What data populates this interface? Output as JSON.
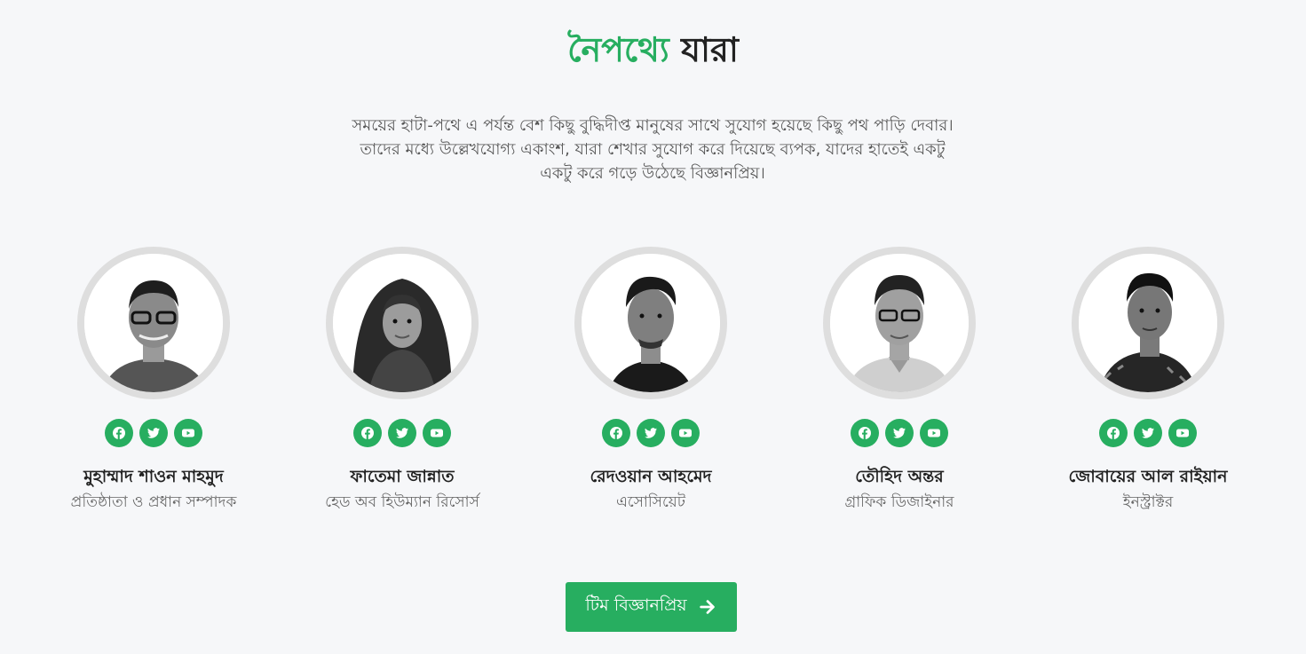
{
  "header": {
    "title_accent": "নৈপথ্যে",
    "title_rest": "যারা",
    "description": "সময়ের হাটা-পথে এ পর্যন্ত বেশ কিছু বুদ্ধিদীপ্ত মানুষের সাথে সুযোগ হয়েছে কিছু পথ পাড়ি দেবার। তাদের মধ্যে উল্লেখযোগ্য একাংশ, যারা শেখার সুযোগ করে দিয়েছে ব্যপক, যাদের হাতেই একটু একটু করে গড়ে উঠেছে বিজ্ঞানপ্রিয়।"
  },
  "members": [
    {
      "name": "মুহাম্মাদ শাওন মাহমুদ",
      "role": "প্রতিষ্ঠাতা ও প্রধান সম্পাদক"
    },
    {
      "name": "ফাতেমা জান্নাত",
      "role": "হেড অব হিউম্যান রিসোর্স"
    },
    {
      "name": "রেদওয়ান আহমেদ",
      "role": "এসোসিয়েট"
    },
    {
      "name": "তৌহিদ অন্তর",
      "role": "গ্রাফিক ডিজাইনার"
    },
    {
      "name": "জোবায়ের আল রাইয়ান",
      "role": "ইনস্ট্রাক্টর"
    }
  ],
  "social_icons": [
    "facebook-icon",
    "twitter-icon",
    "youtube-icon"
  ],
  "cta": {
    "label": "টিম বিজ্ঞানপ্রিয়"
  },
  "colors": {
    "accent": "#27ae60",
    "background": "#f6f7f9",
    "ring": "#dedede"
  }
}
